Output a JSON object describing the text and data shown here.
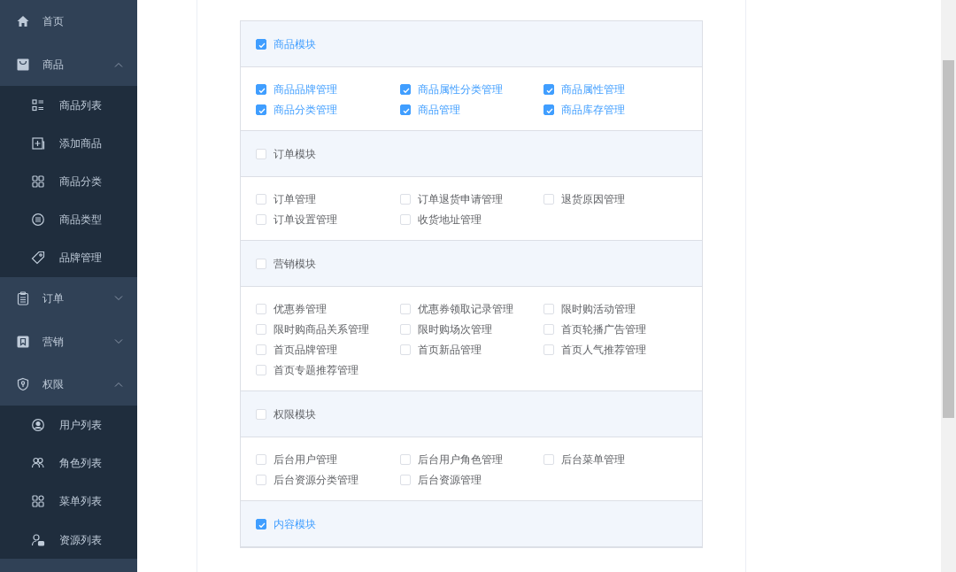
{
  "sidebar": {
    "items": [
      {
        "label": "首页",
        "kind": "link"
      },
      {
        "label": "商品",
        "kind": "group",
        "expanded": true,
        "children": [
          {
            "label": "商品列表"
          },
          {
            "label": "添加商品"
          },
          {
            "label": "商品分类"
          },
          {
            "label": "商品类型"
          },
          {
            "label": "品牌管理"
          }
        ]
      },
      {
        "label": "订单",
        "kind": "group",
        "expanded": false
      },
      {
        "label": "营销",
        "kind": "group",
        "expanded": false
      },
      {
        "label": "权限",
        "kind": "group",
        "expanded": true,
        "children": [
          {
            "label": "用户列表"
          },
          {
            "label": "角色列表"
          },
          {
            "label": "菜单列表"
          },
          {
            "label": "资源列表"
          }
        ]
      }
    ]
  },
  "modules": [
    {
      "label": "商品模块",
      "checked": true,
      "permissions": [
        {
          "label": "商品品牌管理",
          "checked": true
        },
        {
          "label": "商品属性分类管理",
          "checked": true
        },
        {
          "label": "商品属性管理",
          "checked": true
        },
        {
          "label": "商品分类管理",
          "checked": true
        },
        {
          "label": "商品管理",
          "checked": true
        },
        {
          "label": "商品库存管理",
          "checked": true
        }
      ]
    },
    {
      "label": "订单模块",
      "checked": false,
      "permissions": [
        {
          "label": "订单管理",
          "checked": false
        },
        {
          "label": "订单退货申请管理",
          "checked": false
        },
        {
          "label": "退货原因管理",
          "checked": false
        },
        {
          "label": "订单设置管理",
          "checked": false
        },
        {
          "label": "收货地址管理",
          "checked": false
        }
      ]
    },
    {
      "label": "营销模块",
      "checked": false,
      "permissions": [
        {
          "label": "优惠券管理",
          "checked": false
        },
        {
          "label": "优惠券领取记录管理",
          "checked": false
        },
        {
          "label": "限时购活动管理",
          "checked": false
        },
        {
          "label": "限时购商品关系管理",
          "checked": false
        },
        {
          "label": "限时购场次管理",
          "checked": false
        },
        {
          "label": "首页轮播广告管理",
          "checked": false
        },
        {
          "label": "首页品牌管理",
          "checked": false
        },
        {
          "label": "首页新品管理",
          "checked": false
        },
        {
          "label": "首页人气推荐管理",
          "checked": false
        },
        {
          "label": "首页专题推荐管理",
          "checked": false
        }
      ]
    },
    {
      "label": "权限模块",
      "checked": false,
      "permissions": [
        {
          "label": "后台用户管理",
          "checked": false
        },
        {
          "label": "后台用户角色管理",
          "checked": false
        },
        {
          "label": "后台菜单管理",
          "checked": false
        },
        {
          "label": "后台资源分类管理",
          "checked": false
        },
        {
          "label": "后台资源管理",
          "checked": false
        }
      ]
    },
    {
      "label": "内容模块",
      "checked": true
    }
  ]
}
